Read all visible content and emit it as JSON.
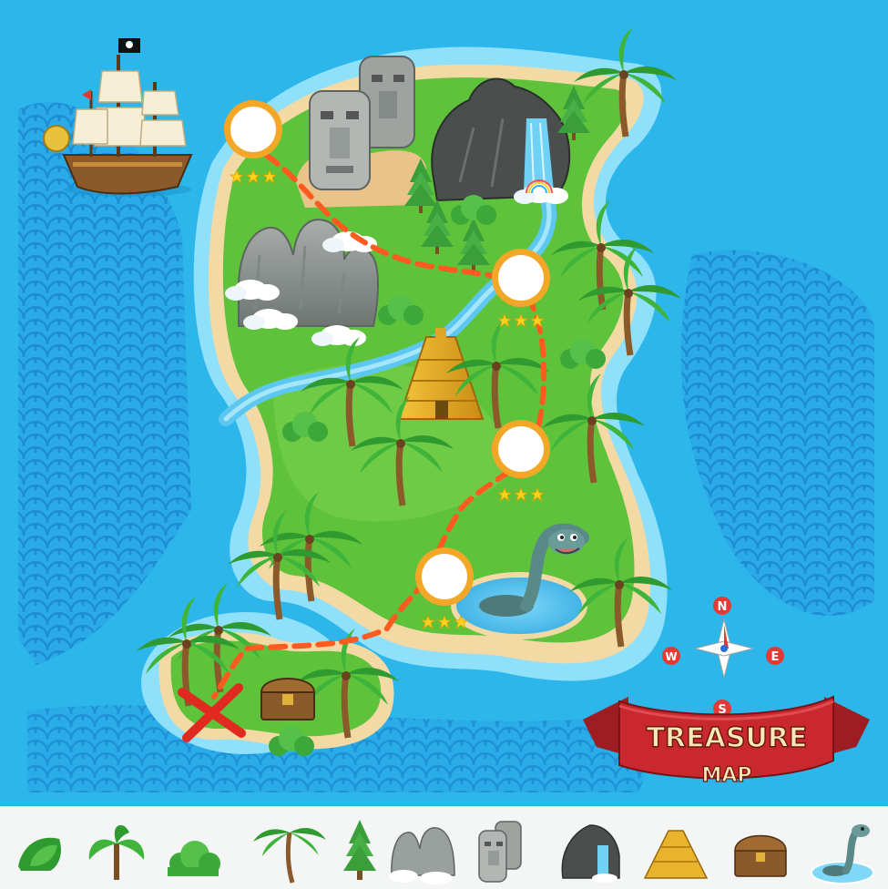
{
  "map": {
    "title_line1": "TREASURE",
    "title_line2": "MAP",
    "compass": {
      "n": "N",
      "s": "S",
      "e": "E",
      "w": "W"
    },
    "colors": {
      "ocean": "#2cb6ea",
      "ocean_pattern": "#1f8fd6",
      "shallow": "#8fe0fb",
      "sand": "#f3d9a4",
      "grass": "#5ec23a",
      "path": "#ff5a1f",
      "banner": "#c8282e"
    },
    "levels": [
      {
        "name": "level-1",
        "stars": 3
      },
      {
        "name": "level-2",
        "stars": 3
      },
      {
        "name": "level-3",
        "stars": 3
      },
      {
        "name": "level-4",
        "stars": 3
      }
    ]
  },
  "tray": {
    "icons": [
      "bush-icon",
      "banana-tree-icon",
      "shrub-icon",
      "palm-tree-icon",
      "pine-tree-icon",
      "rock-mountain-icon",
      "stone-heads-icon",
      "waterfall-rock-icon",
      "pyramid-icon",
      "treasure-chest-icon",
      "sea-monster-icon"
    ]
  }
}
